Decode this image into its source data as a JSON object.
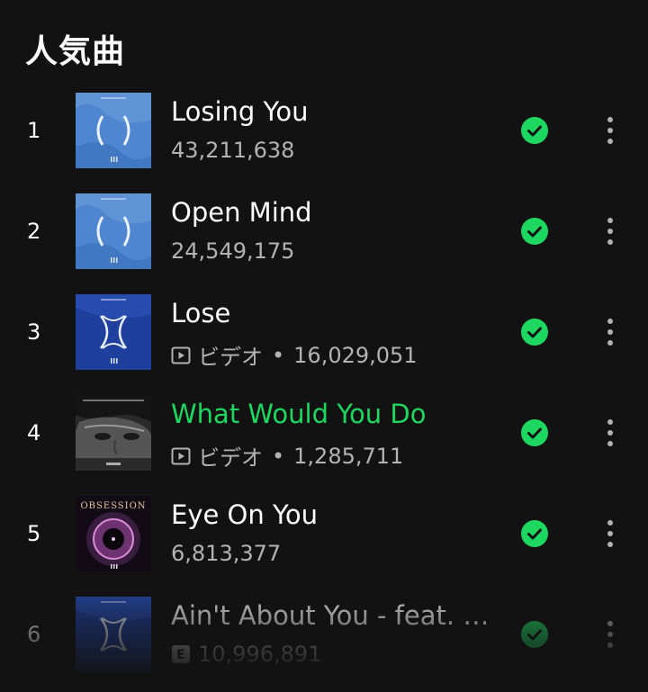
{
  "section": {
    "title": "人気曲"
  },
  "tracks": [
    {
      "rank": "1",
      "title": "Losing You",
      "is_video": false,
      "plays": "43,211,638",
      "playing": false,
      "saved": true,
      "cover": "cover-blue-parentheses"
    },
    {
      "rank": "2",
      "title": "Open Mind",
      "is_video": false,
      "plays": "24,549,175",
      "playing": false,
      "saved": true,
      "cover": "cover-blue-parentheses"
    },
    {
      "rank": "3",
      "title": "Lose",
      "is_video": true,
      "video_label": "ビデオ",
      "separator": "•",
      "plays": "16,029,051",
      "playing": false,
      "saved": true,
      "cover": "cover-blue-x"
    },
    {
      "rank": "4",
      "title": "What Would You Do",
      "is_video": true,
      "video_label": "ビデオ",
      "separator": "•",
      "plays": "1,285,711",
      "playing": true,
      "saved": true,
      "cover": "cover-portrait-face"
    },
    {
      "rank": "5",
      "title": "Eye On You",
      "is_video": false,
      "plays": "6,813,377",
      "playing": false,
      "saved": true,
      "cover": "cover-obsession-ring",
      "cover_text": "OBSESSION"
    },
    {
      "rank": "6",
      "title": "Ain't About You - feat. K...",
      "is_video": false,
      "explicit": true,
      "plays": "10,996,891",
      "playing": false,
      "saved": true,
      "cover": "cover-blue-x"
    }
  ],
  "icons": {
    "saved": "check-circle-icon",
    "more": "more-options-icon",
    "video": "video-play-icon",
    "explicit": "explicit-icon"
  },
  "colors": {
    "background": "#121212",
    "accent": "#1ed760",
    "text_primary": "#ffffff",
    "text_secondary": "#b3b3b3"
  }
}
